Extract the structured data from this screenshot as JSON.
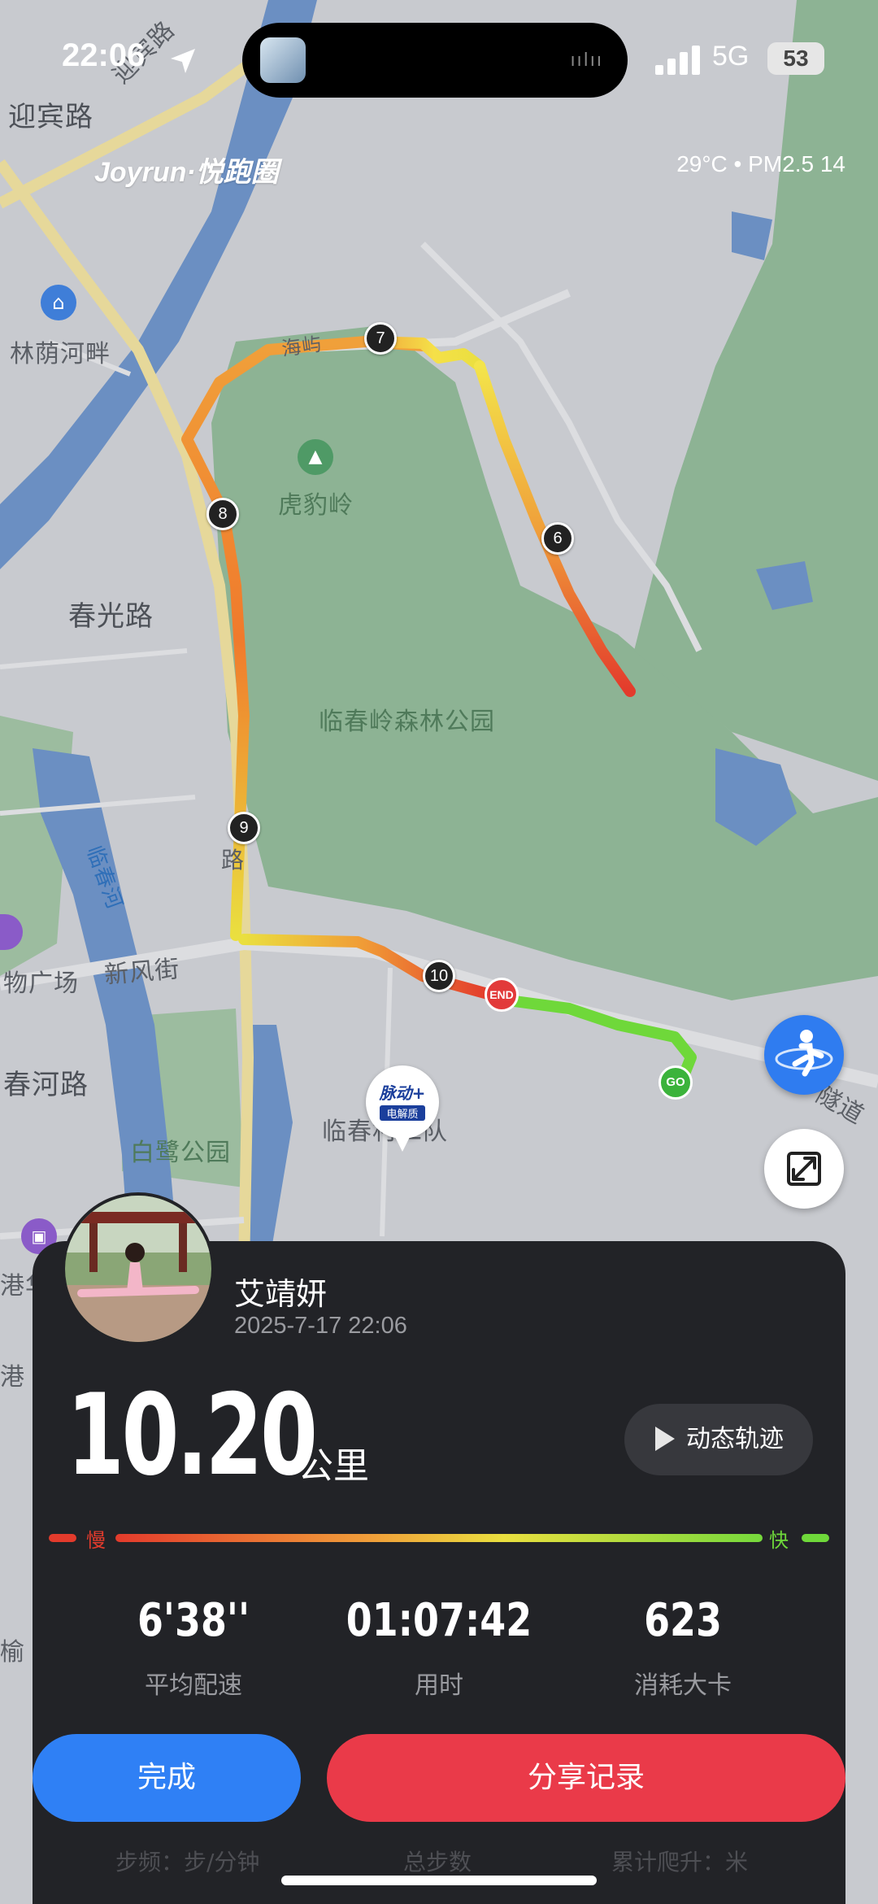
{
  "status_bar": {
    "time": "22:06",
    "network": "5G",
    "battery": "53"
  },
  "header": {
    "brand": "Joyrun·悦跑圈",
    "weather": "29°C • PM2.5 14"
  },
  "map_labels": {
    "yingbin_road": "迎宾路",
    "yingbin_road2": "迎宾路",
    "linyin_hepan": "林荫河畔",
    "hubaoling": "虎豹岭",
    "chunguang_road": "春光路",
    "park": "临春岭森林公园",
    "linchun_river": "临春河",
    "xinfeng_street": "新风街",
    "plaza": "物广场",
    "chunhe_road": "春河路",
    "bailu_park": "白鹭公园",
    "linchun_team": "临春村二队",
    "gang_hua": "港华",
    "gang": "港",
    "yu": "榆",
    "haiyu": "海屿",
    "tunnel": "隧道",
    "road_vertical": "路"
  },
  "route_markers": [
    "7",
    "8",
    "6",
    "9",
    "10"
  ],
  "end_label": "END",
  "go_label": "GO",
  "poi": {
    "line1": "脉动+",
    "line2": "电解质"
  },
  "card": {
    "username": "艾靖妍",
    "datetime": "2025-7-17 22:06",
    "distance": "10.20",
    "unit": "公里",
    "dynamic_track": "动态轨迹",
    "slow": "慢",
    "fast": "快",
    "stats": [
      {
        "value": "6'38''",
        "label": "平均配速"
      },
      {
        "value": "01:07:42",
        "label": "用时"
      },
      {
        "value": "623",
        "label": "消耗大卡"
      }
    ],
    "done": "完成",
    "share": "分享记录",
    "extra": [
      "步频：步/分钟",
      "总步数",
      "累计爬升：米"
    ]
  },
  "colors": {
    "route_fast": "#6fd83a",
    "route_slow": "#e33b2c",
    "accent_blue": "#2f80f5",
    "accent_red": "#ea3a49"
  }
}
